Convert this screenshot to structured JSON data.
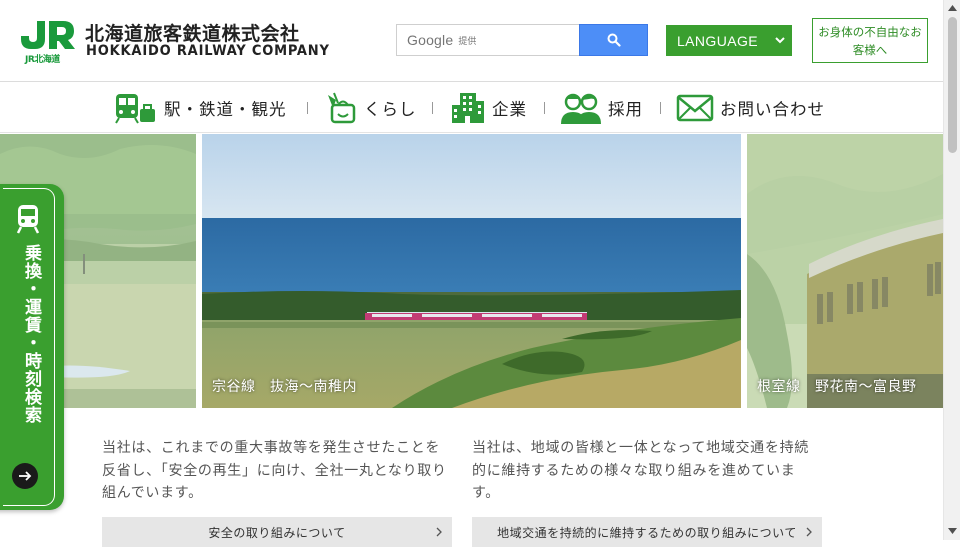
{
  "header": {
    "logo_jr": "JR",
    "logo_sub": "JR北海道",
    "company_jp": "北海道旅客鉄道株式会社",
    "company_en": "HOKKAIDO RAILWAY COMPANY",
    "search_brand": "Google",
    "search_provided": "提供",
    "language_label": "LANGUAGE",
    "accessibility_label": "お身体の不自由なお客様へ"
  },
  "nav": {
    "items": [
      {
        "label": "駅・鉄道・観光",
        "icon": "train-luggage-icon"
      },
      {
        "label": "くらし",
        "icon": "shopping-bag-icon"
      },
      {
        "label": "企業",
        "icon": "building-icon"
      },
      {
        "label": "採用",
        "icon": "people-icon"
      },
      {
        "label": "お問い合わせ",
        "icon": "envelope-icon"
      }
    ]
  },
  "hero": {
    "slides": [
      {
        "caption": ""
      },
      {
        "caption": "宗谷線　抜海～南稚内"
      },
      {
        "caption": "根室線　野花南～富良野"
      }
    ]
  },
  "sidetab": {
    "label": "乗換・運賃・時刻検索"
  },
  "content": {
    "left_text": "当社は、これまでの重大事故等を発生させたことを反省し、「安全の再生」に向け、全社一丸となり取り組んでいます。",
    "left_link": "安全の取り組みについて",
    "right_text": "当社は、地域の皆様と一体となって地域交通を持続的に維持するための様々な取り組みを進めています。",
    "right_link": "地域交通を持続的に維持するための取り組みについて"
  },
  "colors": {
    "brand_green": "#3a9f2f",
    "google_blue": "#4d8ef7"
  }
}
